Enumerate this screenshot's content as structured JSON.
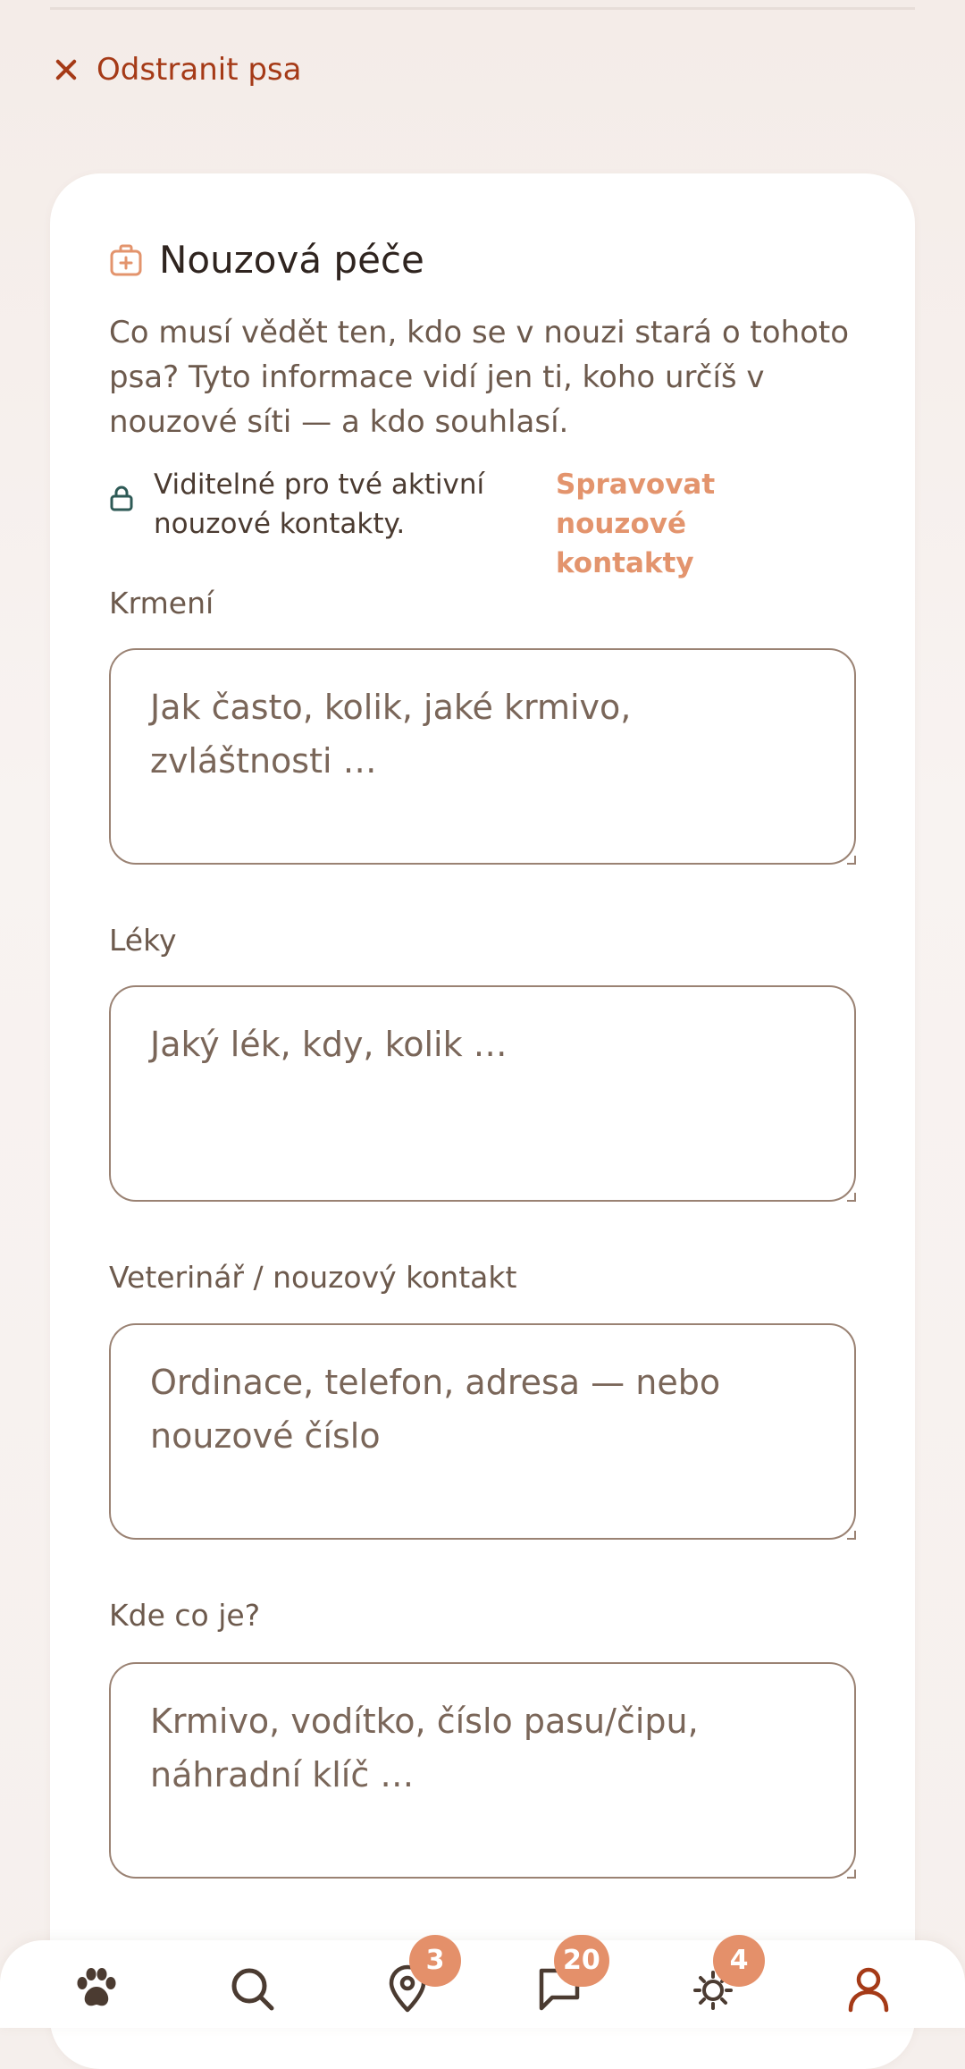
{
  "remove_dog": {
    "label": "Odstranit psa",
    "icon": "close-icon"
  },
  "emergency_care": {
    "title": "Nouzová péče",
    "icon": "first-aid-kit-icon",
    "description": "Co musí vědět ten, kdo se v nouzi stará o tohoto psa? Tyto informace vidí jen ti, koho určíš v nouzové síti — a kdo souhlasí.",
    "visibility_text": "Viditelné pro tvé aktivní nouzové kontakty.",
    "visibility_icon": "lock-icon",
    "manage_link": "Spravovat nouzové kontakty",
    "fields": [
      {
        "label": "Krmení",
        "placeholder": "Jak často, kolik, jaké krmivo, zvláštnosti …",
        "value": ""
      },
      {
        "label": "Léky",
        "placeholder": "Jaký lék, kdy, kolik …",
        "value": ""
      },
      {
        "label": "Veterinář / nouzový kontakt",
        "placeholder": "Ordinace, telefon, adresa — nebo nouzové číslo",
        "value": ""
      },
      {
        "label": "Kde co je?",
        "placeholder": "Krmivo, vodítko, číslo pasu/čipu, náhradní klíč …",
        "value": ""
      }
    ]
  },
  "bottom_nav": {
    "items": [
      {
        "name": "dogs",
        "icon": "paw-icon",
        "badge": ""
      },
      {
        "name": "search",
        "icon": "search-icon",
        "badge": ""
      },
      {
        "name": "map",
        "icon": "map-pin-icon",
        "badge": "3"
      },
      {
        "name": "messages",
        "icon": "chat-icon",
        "badge": "20"
      },
      {
        "name": "notifications",
        "icon": "sun-icon",
        "badge": "4"
      },
      {
        "name": "profile",
        "icon": "user-icon",
        "badge": ""
      }
    ],
    "active_color": "#a53a17",
    "icon_color": "#4b3b31",
    "badge_color": "#e4906a"
  },
  "colors": {
    "accent_danger": "#a53a17",
    "accent_link": "#e3946d",
    "text_primary": "#2f241f",
    "text_secondary": "#6d5a4d",
    "input_border": "#9a8273"
  }
}
